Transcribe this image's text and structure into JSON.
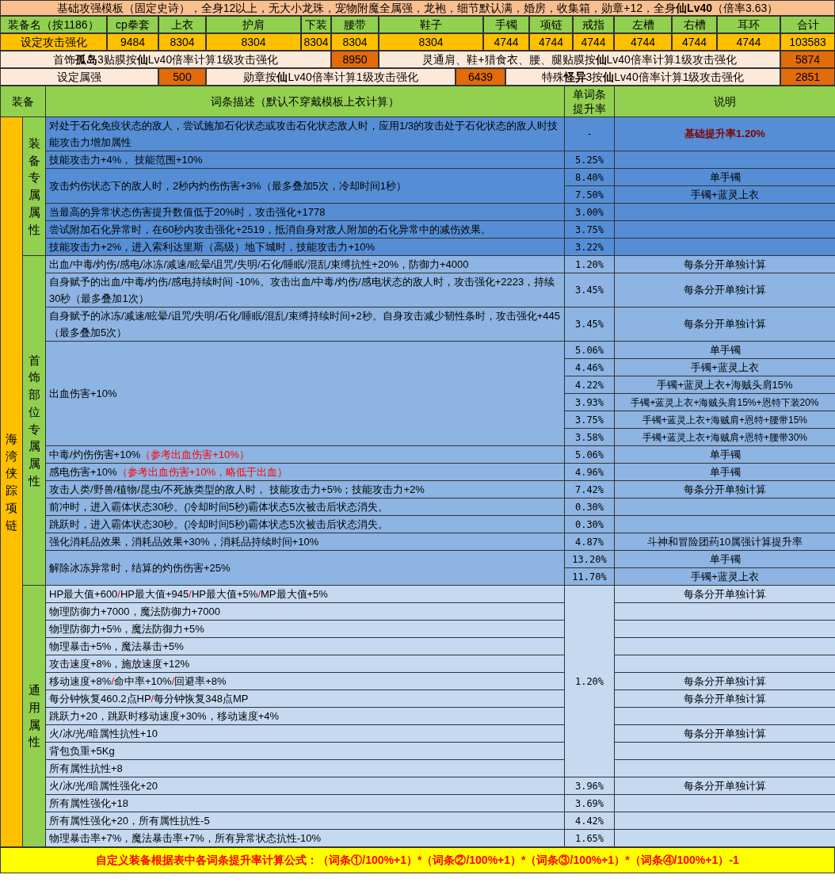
{
  "title_bar": {
    "text": "基础攻强模板（固定史诗），全身12以上，无大小龙珠，宠物附魔全属强，龙袍，细节默认满，婚房，收集箱，勋章+12，全身**仙Lv40**（倍率3.63）"
  },
  "slot_header": [
    "装备名（按1186）",
    "cp拳套",
    "上衣",
    "护肩",
    "下装",
    "腰带",
    "鞋子",
    "手镯",
    "项链",
    "戒指",
    "左槽",
    "右槽",
    "耳环",
    "合计"
  ],
  "attack_row": [
    "设定攻击强化",
    "9484",
    "8304",
    "8304",
    "8304",
    "8304",
    "8304",
    "4744",
    "4744",
    "4744",
    "4744",
    "4744",
    "4744",
    "103583"
  ],
  "setting_rows": [
    [
      {
        "kind": "label",
        "text": "首饰**孤岛**3贴膜按**仙**Lv40倍率计算1级攻击强化"
      },
      {
        "kind": "value",
        "text": "8950"
      },
      {
        "kind": "label",
        "text": "灵通肩、鞋+猎食衣、腰、腿贴膜按**仙**Lv40倍率计算1级攻击强化"
      },
      {
        "kind": "value",
        "text": "5874"
      }
    ],
    [
      {
        "kind": "label",
        "text": "设定属强"
      },
      {
        "kind": "value",
        "text": "500"
      },
      {
        "kind": "label",
        "text": "勋章按**仙**Lv40倍率计算1级攻击强化"
      },
      {
        "kind": "value",
        "text": "6439"
      },
      {
        "kind": "label",
        "text": "特殊**怪异**3按**仙**Lv40倍率计算1级攻击强化"
      },
      {
        "kind": "value",
        "text": "2851"
      }
    ]
  ],
  "table": {
    "columns": [
      [
        "装备"
      ],
      [
        "词条描述（默认不穿戴模板上衣计算）"
      ],
      [
        "单词条",
        "提升率"
      ],
      [
        "说明"
      ]
    ],
    "item": "海湾侠踪项链",
    "groups": [
      {
        "label": "装备专属属性",
        "color": "#558ed5",
        "rows": [
          {
            "description": "对处于石化免疫状态的敌人，尝试施加石化状态或攻击石化状态敌人时，应用1/3的攻击处于石化状态的敌人时技能攻击力增加属性",
            "subs": [
              {
                "rate": "-",
                "note": "基础提升率1.20%",
                "note_highlight": true
              }
            ]
          },
          {
            "description": "技能攻击力+4%， 技能范围+10%",
            "subs": [
              {
                "rate": "5.25%"
              }
            ]
          },
          {
            "description": "攻击灼伤状态下的敌人时，2秒内灼伤伤害+3%（最多叠加5次，冷却时间1秒）",
            "subs": [
              {
                "rate": "8.40%",
                "note": "单手镯",
                "note_highlight": false
              },
              {
                "rate": "7.50%",
                "note": "手镯+蓝灵上衣",
                "note_highlight": false
              }
            ]
          },
          {
            "description": "当最高的异常状态伤害提升数值低于20%时，攻击强化+1778",
            "subs": [
              {
                "rate": "3.00%"
              }
            ]
          },
          {
            "description": "尝试附加石化异常时，在60秒内攻击强化+2519，抵消自身对敌人附加的石化异常中的减伤效果。",
            "subs": [
              {
                "rate": "3.75%"
              }
            ]
          },
          {
            "description": "技能攻击力+2%，进入索利达里斯（高级）地下城时，技能攻击力+10%",
            "subs": [
              {
                "rate": "3.22%"
              }
            ]
          }
        ]
      },
      {
        "label": "首饰部位专属属性",
        "color": "#8db4e2",
        "rows": [
          {
            "description": "出血/中毒/灼伤/感电/冰冻/减速/眩晕/诅咒/失明/石化/睡眠/混乱/束缚抗性+20%，防御力+4000",
            "subs": [
              {
                "rate": "1.20%",
                "note": "每条分开单独计算",
                "note_highlight": false
              }
            ]
          },
          {
            "description": "自身赋予的出血/中毒/灼伤/感电持续时间 -10%。攻击出血/中毒/灼伤/感电状态的敌人时，攻击强化+2223，持续30秒（最多叠加1次）",
            "subs": [
              {
                "rate": "3.45%",
                "note": "每条分开单独计算",
                "note_highlight": false
              }
            ]
          },
          {
            "description": "自身赋予的冰冻/减速/眩晕/诅咒/失明/石化/睡眠/混乱/束缚持续时间+2秒。自身攻击减少韧性条时，攻击强化+445（最多叠加5次）",
            "subs": [
              {
                "rate": "3.45%",
                "note": "每条分开单独计算",
                "note_highlight": false
              }
            ]
          },
          {
            "description": "出血伤害+10%",
            "subs": [
              {
                "rate": "5.06%",
                "note": "单手镯",
                "note_highlight": false
              },
              {
                "rate": "4.46%",
                "note": "手镯+蓝灵上衣",
                "note_highlight": false
              },
              {
                "rate": "4.22%",
                "note": "手镯+蓝灵上衣+海贼头肩15%",
                "note_highlight": false
              },
              {
                "rate": "3.93%",
                "note": "手镯+蓝灵上衣+海贼头肩15%+恩特下装20%",
                "note_highlight": false
              },
              {
                "rate": "3.75%",
                "note": "手镯+蓝灵上衣+海贼肩+恩特+腰带15%",
                "note_highlight": false
              },
              {
                "rate": "3.58%",
                "note": "手镯+蓝灵上衣+海贼肩+恩特+腰带30%",
                "note_highlight": false
              }
            ]
          },
          {
            "segments": [
              {
                "text": "中毒/灼伤伤害+10%",
                "highlight": false
              },
              {
                "text": "（参考出血伤害+10%）",
                "highlight": true
              }
            ],
            "subs": [
              {
                "rate": "5.06%",
                "note": "单手镯",
                "note_highlight": false
              }
            ]
          },
          {
            "segments": [
              {
                "text": "感电伤害+10%",
                "highlight": false
              },
              {
                "text": "（参考出血伤害+10%，略低于出血）",
                "highlight": true
              }
            ],
            "subs": [
              {
                "rate": "4.96%",
                "note": "单手镯",
                "note_highlight": false
              }
            ]
          },
          {
            "description": "攻击人类/野兽/植物/昆虫/不死族类型的敌人时， 技能攻击力+5%；技能攻击力+2%",
            "subs": [
              {
                "rate": "7.42%",
                "note": "每条分开单独计算",
                "note_highlight": false
              }
            ]
          },
          {
            "description": "前冲时，进入霸体状态30秒。(冷却时间5秒)霸体状态5次被击后状态消失。",
            "subs": [
              {
                "rate": "0.30%"
              }
            ]
          },
          {
            "description": "跳跃时，进入霸体状态30秒。(冷却时间5秒)霸体状态5次被击后状态消失。",
            "subs": [
              {
                "rate": "0.30%"
              }
            ]
          },
          {
            "description": "强化消耗品效果，消耗品效果+30%，消耗品持续时间+10%",
            "subs": [
              {
                "rate": "4.87%",
                "note": "斗神和冒险团药10属强计算提升率",
                "note_highlight": false
              }
            ]
          },
          {
            "description": "解除冰冻异常时，结算的灼伤伤害+25%",
            "subs": [
              {
                "rate": "13.20%",
                "note": "单手镯",
                "note_highlight": false
              },
              {
                "rate": "11.70%",
                "note": "手镯+蓝灵上衣",
                "note_highlight": false
              }
            ]
          }
        ]
      },
      {
        "label": "通用属性",
        "color": "#c5d9f1",
        "shared_rate": "1.20%",
        "rows": [
          {
            "segments": [
              {
                "text": "HP最大值+600",
                "highlight": false
              },
              {
                "text": "/",
                "highlight": true
              },
              {
                "text": "HP最大值+945",
                "highlight": false
              },
              {
                "text": "/",
                "highlight": true
              },
              {
                "text": "HP最大值+5%",
                "highlight": false
              },
              {
                "text": "/",
                "highlight": true
              },
              {
                "text": "MP最大值+5%",
                "highlight": false
              }
            ],
            "subs": [
              {
                "note": "每条分开单独计算",
                "note_highlight": false
              }
            ]
          },
          {
            "description": "物理防御力+7000，魔法防御力+7000"
          },
          {
            "description": "物理防御力+5%，魔法防御力+5%"
          },
          {
            "description": "物理暴击+5%，魔法暴击+5%"
          },
          {
            "description": "攻击速度+8%，施放速度+12%"
          },
          {
            "segments": [
              {
                "text": "移动速度+8%",
                "highlight": false
              },
              {
                "text": "/",
                "highlight": true
              },
              {
                "text": "命中率+10%",
                "highlight": false
              },
              {
                "text": "/",
                "highlight": true
              },
              {
                "text": "回避率+8%",
                "highlight": false
              }
            ],
            "subs": [
              {
                "note": "每条分开单独计算",
                "note_highlight": false
              }
            ]
          },
          {
            "segments": [
              {
                "text": "每分钟恢复460.2点HP",
                "highlight": false
              },
              {
                "text": "/",
                "highlight": true
              },
              {
                "text": "每分钟恢复348点MP",
                "highlight": false
              }
            ],
            "subs": [
              {
                "note": "每条分开单独计算",
                "note_highlight": false
              }
            ]
          },
          {
            "description": "跳跃力+20，跳跃时移动速度+30%，移动速度+4%"
          },
          {
            "description": "火/冰/光/暗属性抗性+10",
            "subs": [
              {
                "note": "每条分开单独计算",
                "note_highlight": false
              }
            ]
          },
          {
            "description": "背包负重+5Kg"
          },
          {
            "description": "所有属性抗性+8"
          },
          {
            "description": "火/冰/光/暗属性强化+20",
            "subs": [
              {
                "rate": "3.96%",
                "note": "每条分开单独计算",
                "note_highlight": false
              }
            ]
          },
          {
            "description": "所有属性强化+18",
            "subs": [
              {
                "rate": "3.69%"
              }
            ]
          },
          {
            "description": "所有属性强化+20，所有属性抗性-5",
            "subs": [
              {
                "rate": "4.42%"
              }
            ]
          },
          {
            "description": "物理暴击率+7%，魔法暴击率+7%，所有异常状态抗性-10%",
            "subs": [
              {
                "rate": "1.65%"
              }
            ]
          }
        ]
      }
    ]
  },
  "footer": {
    "text": "自定义装备根据表中各词条提升率计算公式：（词条①/100%+1）*（词条②/100%+1）*（词条③/100%+1）*（词条④/100%+1）-1"
  }
}
